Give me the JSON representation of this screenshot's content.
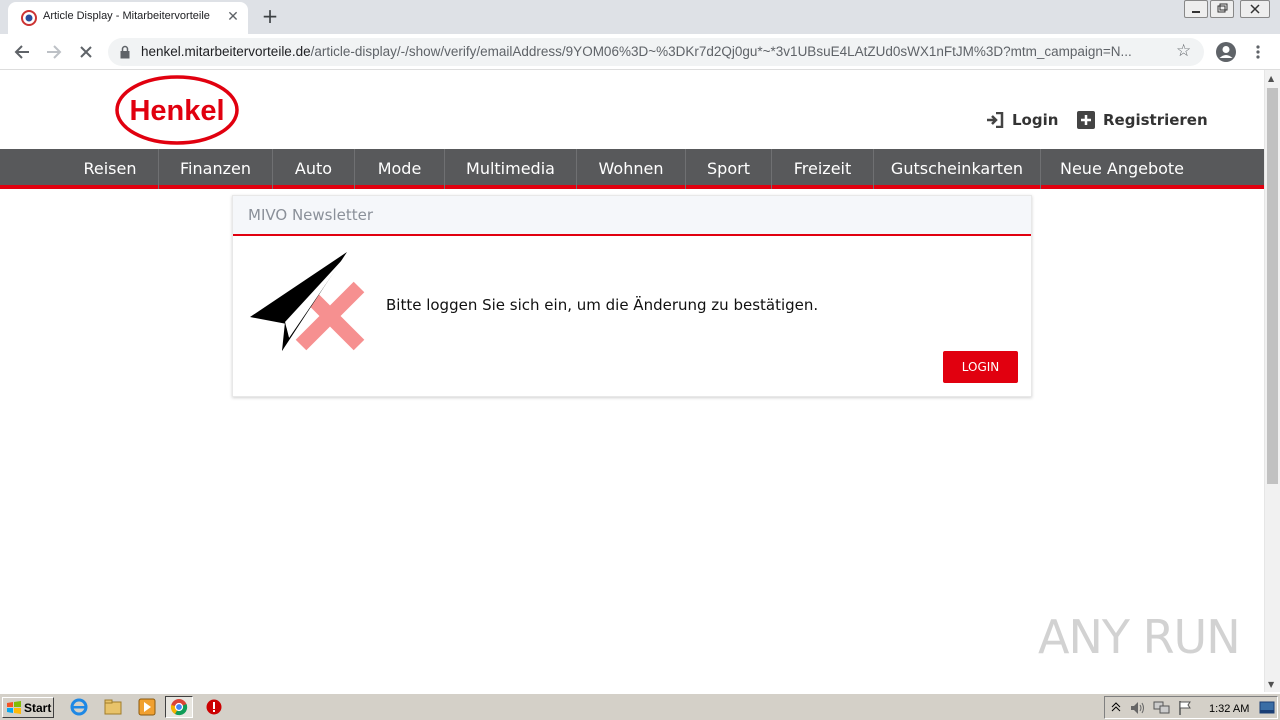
{
  "browser": {
    "tab_title": "Article Display - Mitarbeitervorteile",
    "tab_close": "✕",
    "new_tab": "+",
    "url_host": "henkel.mitarbeitervorteile.de",
    "url_path": "/article-display/-/show/verify/emailAddress/9YOM06%3D~%3DKr7d2Qj0gu*~*3v1UBsuE4LAtZUd0sWX1nFtJM%3D?mtm_campaign=N..."
  },
  "site": {
    "logo_text": "Henkel",
    "login_label": "Login",
    "register_label": "Registrieren",
    "nav": [
      "Reisen",
      "Finanzen",
      "Auto",
      "Mode",
      "Multimedia",
      "Wohnen",
      "Sport",
      "Freizeit",
      "Gutscheinkarten",
      "Neue Angebote"
    ]
  },
  "card": {
    "title": "MIVO Newsletter",
    "message": "Bitte loggen Sie sich ein, um die Änderung zu bestätigen.",
    "button": "LOGIN"
  },
  "watermark": "ANY RUN",
  "taskbar": {
    "start_label": "Start",
    "clock": "1:32 AM"
  },
  "colors": {
    "accent": "#e1000f",
    "nav_bg": "#58595b"
  }
}
